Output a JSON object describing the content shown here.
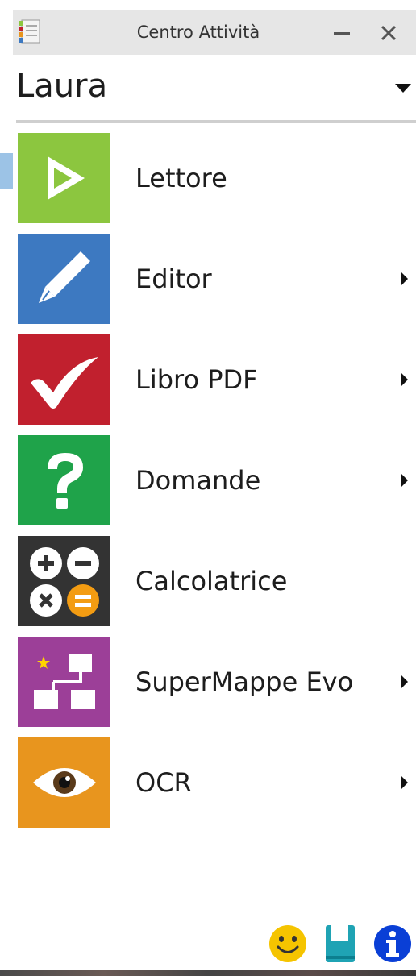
{
  "window": {
    "title": "Centro Attività",
    "minimize_icon": "minimize-icon",
    "close_icon": "close-icon"
  },
  "user": {
    "name": "Laura",
    "dropdown_icon": "caret-down-icon"
  },
  "menu": {
    "items": [
      {
        "label": "Lettore",
        "icon": "play-icon",
        "color": "#8cc63f",
        "has_submenu": false
      },
      {
        "label": "Editor",
        "icon": "pencil-icon",
        "color": "#3d79c1",
        "has_submenu": true
      },
      {
        "label": "Libro PDF",
        "icon": "checkmark-icon",
        "color": "#c1202e",
        "has_submenu": true
      },
      {
        "label": "Domande",
        "icon": "question-mark-icon",
        "color": "#1fa34a",
        "has_submenu": true
      },
      {
        "label": "Calcolatrice",
        "icon": "calculator-operators-icon",
        "color": "#333333",
        "has_submenu": false
      },
      {
        "label": "SuperMappe Evo",
        "icon": "concept-map-icon",
        "color": "#9c3f98",
        "has_submenu": true
      },
      {
        "label": "OCR",
        "icon": "eye-icon",
        "color": "#e8951e",
        "has_submenu": true
      }
    ]
  },
  "footer": {
    "icons": [
      "smiley-icon",
      "book-icon",
      "info-icon"
    ],
    "colors": {
      "smiley": "#f5c400",
      "book": "#1fa3b4",
      "info": "#0a3fd6"
    }
  }
}
